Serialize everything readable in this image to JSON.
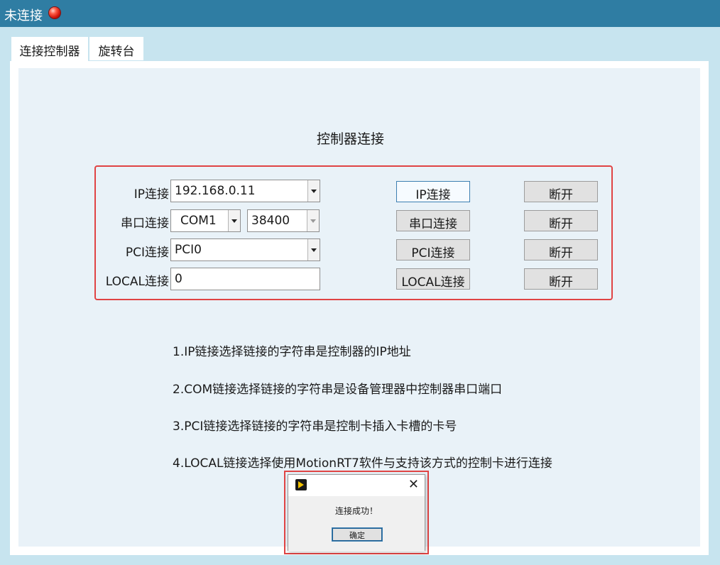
{
  "window": {
    "title": "未连接",
    "status_color": "#e01a0e"
  },
  "tabs": [
    {
      "label": "连接控制器",
      "active": true
    },
    {
      "label": "旋转台",
      "active": false
    }
  ],
  "panel": {
    "heading": "控制器连接",
    "rows": [
      {
        "label": "IP连接",
        "value": "192.168.0.11",
        "connect_label": "IP连接",
        "disconnect_label": "断开"
      },
      {
        "label": "串口连接",
        "port": "COM1",
        "baud": "38400",
        "connect_label": "串口连接",
        "disconnect_label": "断开"
      },
      {
        "label": "PCI连接",
        "value": "PCI0",
        "connect_label": "PCI连接",
        "disconnect_label": "断开"
      },
      {
        "label": "LOCAL连接",
        "value": "0",
        "connect_label": "LOCAL连接",
        "disconnect_label": "断开"
      }
    ],
    "notes": [
      "1.IP链接选择链接的字符串是控制器的IP地址",
      "2.COM链接选择链接的字符串是设备管理器中控制器串口端口",
      "3.PCI链接选择链接的字符串是控制卡插入卡槽的卡号",
      "4.LOCAL链接选择使用MotionRT7软件与支持该方式的控制卡进行连接"
    ]
  },
  "dialog": {
    "close_glyph": "✕",
    "message": "连接成功！",
    "ok_label": "确定"
  },
  "colors": {
    "titlebar": "#2f7da3",
    "highlight": "#e04444",
    "background": "#c7e4ef"
  }
}
